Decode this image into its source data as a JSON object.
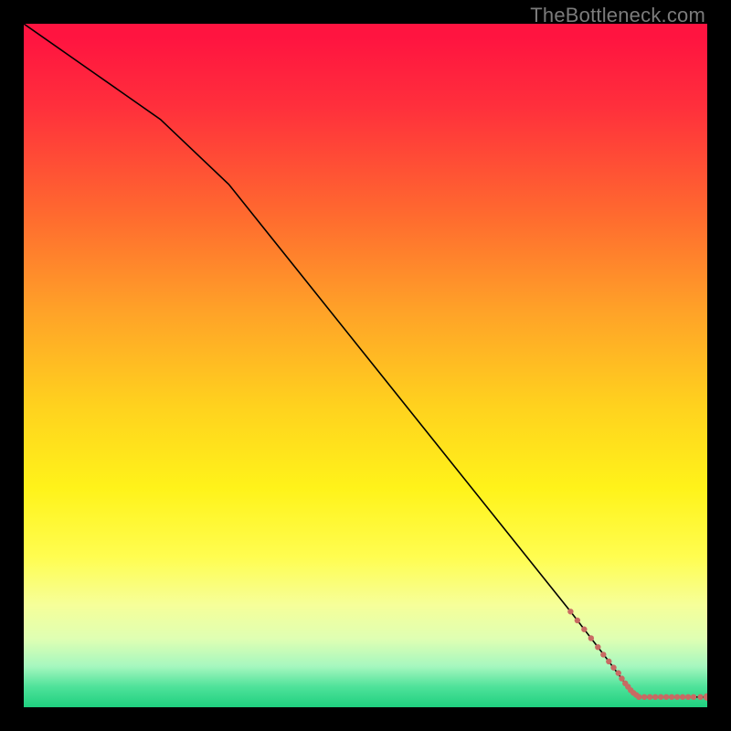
{
  "watermark": "TheBottleneck.com",
  "chart_data": {
    "type": "line",
    "title": "",
    "xlabel": "",
    "ylabel": "",
    "xlim": [
      0,
      100
    ],
    "ylim": [
      0,
      100
    ],
    "grid": false,
    "legend": false,
    "series": [
      {
        "name": "curve",
        "style": "line-black",
        "x": [
          0,
          10,
          20,
          30,
          40,
          50,
          60,
          70,
          80,
          85,
          88,
          90,
          100
        ],
        "y": [
          100,
          93,
          86,
          76.5,
          64,
          51.5,
          39,
          26.5,
          14,
          7.5,
          3.5,
          1.5,
          1.5
        ]
      },
      {
        "name": "markers-descending",
        "style": "dots-salmon",
        "x": [
          80.0,
          81.0,
          82.0,
          83.0,
          84.0,
          84.8,
          85.6,
          86.3,
          87.0,
          87.5,
          88.0,
          88.4,
          88.8,
          89.2,
          89.6,
          90.0
        ],
        "y": [
          14.0,
          12.7,
          11.4,
          10.1,
          8.8,
          7.7,
          6.7,
          5.8,
          5.0,
          4.2,
          3.5,
          3.0,
          2.5,
          2.1,
          1.8,
          1.5
        ]
      },
      {
        "name": "markers-tail",
        "style": "dots-salmon",
        "x": [
          90.0,
          90.8,
          91.6,
          92.4,
          93.2,
          94.0,
          94.8,
          95.6,
          96.4,
          97.2,
          98.0,
          99.0,
          100.0
        ],
        "y": [
          1.5,
          1.5,
          1.5,
          1.5,
          1.5,
          1.5,
          1.5,
          1.5,
          1.5,
          1.5,
          1.5,
          1.5,
          1.5
        ]
      }
    ]
  },
  "colors": {
    "marker": "#c86a63",
    "line": "#000000",
    "frame": "#000000"
  }
}
